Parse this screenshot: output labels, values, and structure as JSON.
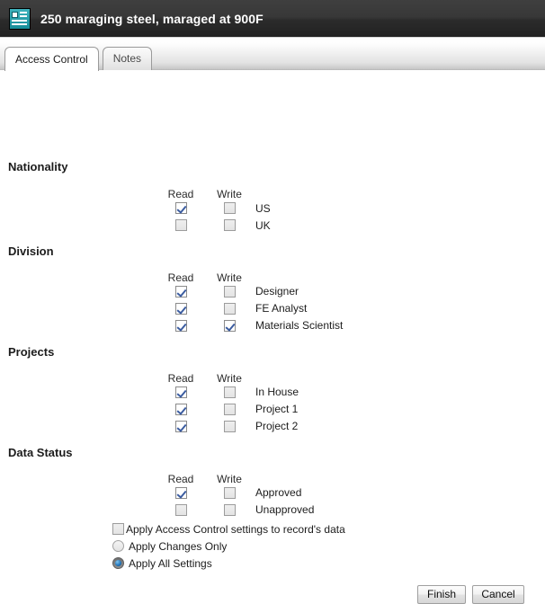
{
  "window": {
    "icon": "record-document-icon",
    "title": "250 maraging steel, maraged at 900F"
  },
  "tabs": [
    {
      "label": "Access Control",
      "active": true
    },
    {
      "label": "Notes",
      "active": false
    }
  ],
  "columns": {
    "read": "Read",
    "write": "Write"
  },
  "sections": [
    {
      "title": "Nationality",
      "rows": [
        {
          "label": "US",
          "read": true,
          "write": false
        },
        {
          "label": "UK",
          "read": false,
          "write": false
        }
      ]
    },
    {
      "title": "Division",
      "rows": [
        {
          "label": "Designer",
          "read": true,
          "write": false
        },
        {
          "label": "FE Analyst",
          "read": true,
          "write": false
        },
        {
          "label": "Materials Scientist",
          "read": true,
          "write": true
        }
      ]
    },
    {
      "title": "Projects",
      "rows": [
        {
          "label": "In House",
          "read": true,
          "write": false
        },
        {
          "label": "Project 1",
          "read": true,
          "write": false
        },
        {
          "label": "Project 2",
          "read": true,
          "write": false
        }
      ]
    },
    {
      "title": "Data Status",
      "rows": [
        {
          "label": "Approved",
          "read": true,
          "write": false
        },
        {
          "label": "Unapproved",
          "read": false,
          "write": false
        }
      ]
    }
  ],
  "options": {
    "apply_to_record": {
      "label": "Apply Access Control settings to record's data",
      "checked": false
    },
    "radios": [
      {
        "label": "Apply Changes Only",
        "selected": false
      },
      {
        "label": "Apply All Settings",
        "selected": true
      }
    ]
  },
  "buttons": {
    "finish": "Finish",
    "cancel": "Cancel"
  },
  "colors": {
    "titlebar_top": "#3f3f3f",
    "titlebar_bottom": "#222222",
    "icon_teal": "#168d99",
    "check_blue": "#3b5ca0",
    "radio_blue": "#1f72b8"
  }
}
